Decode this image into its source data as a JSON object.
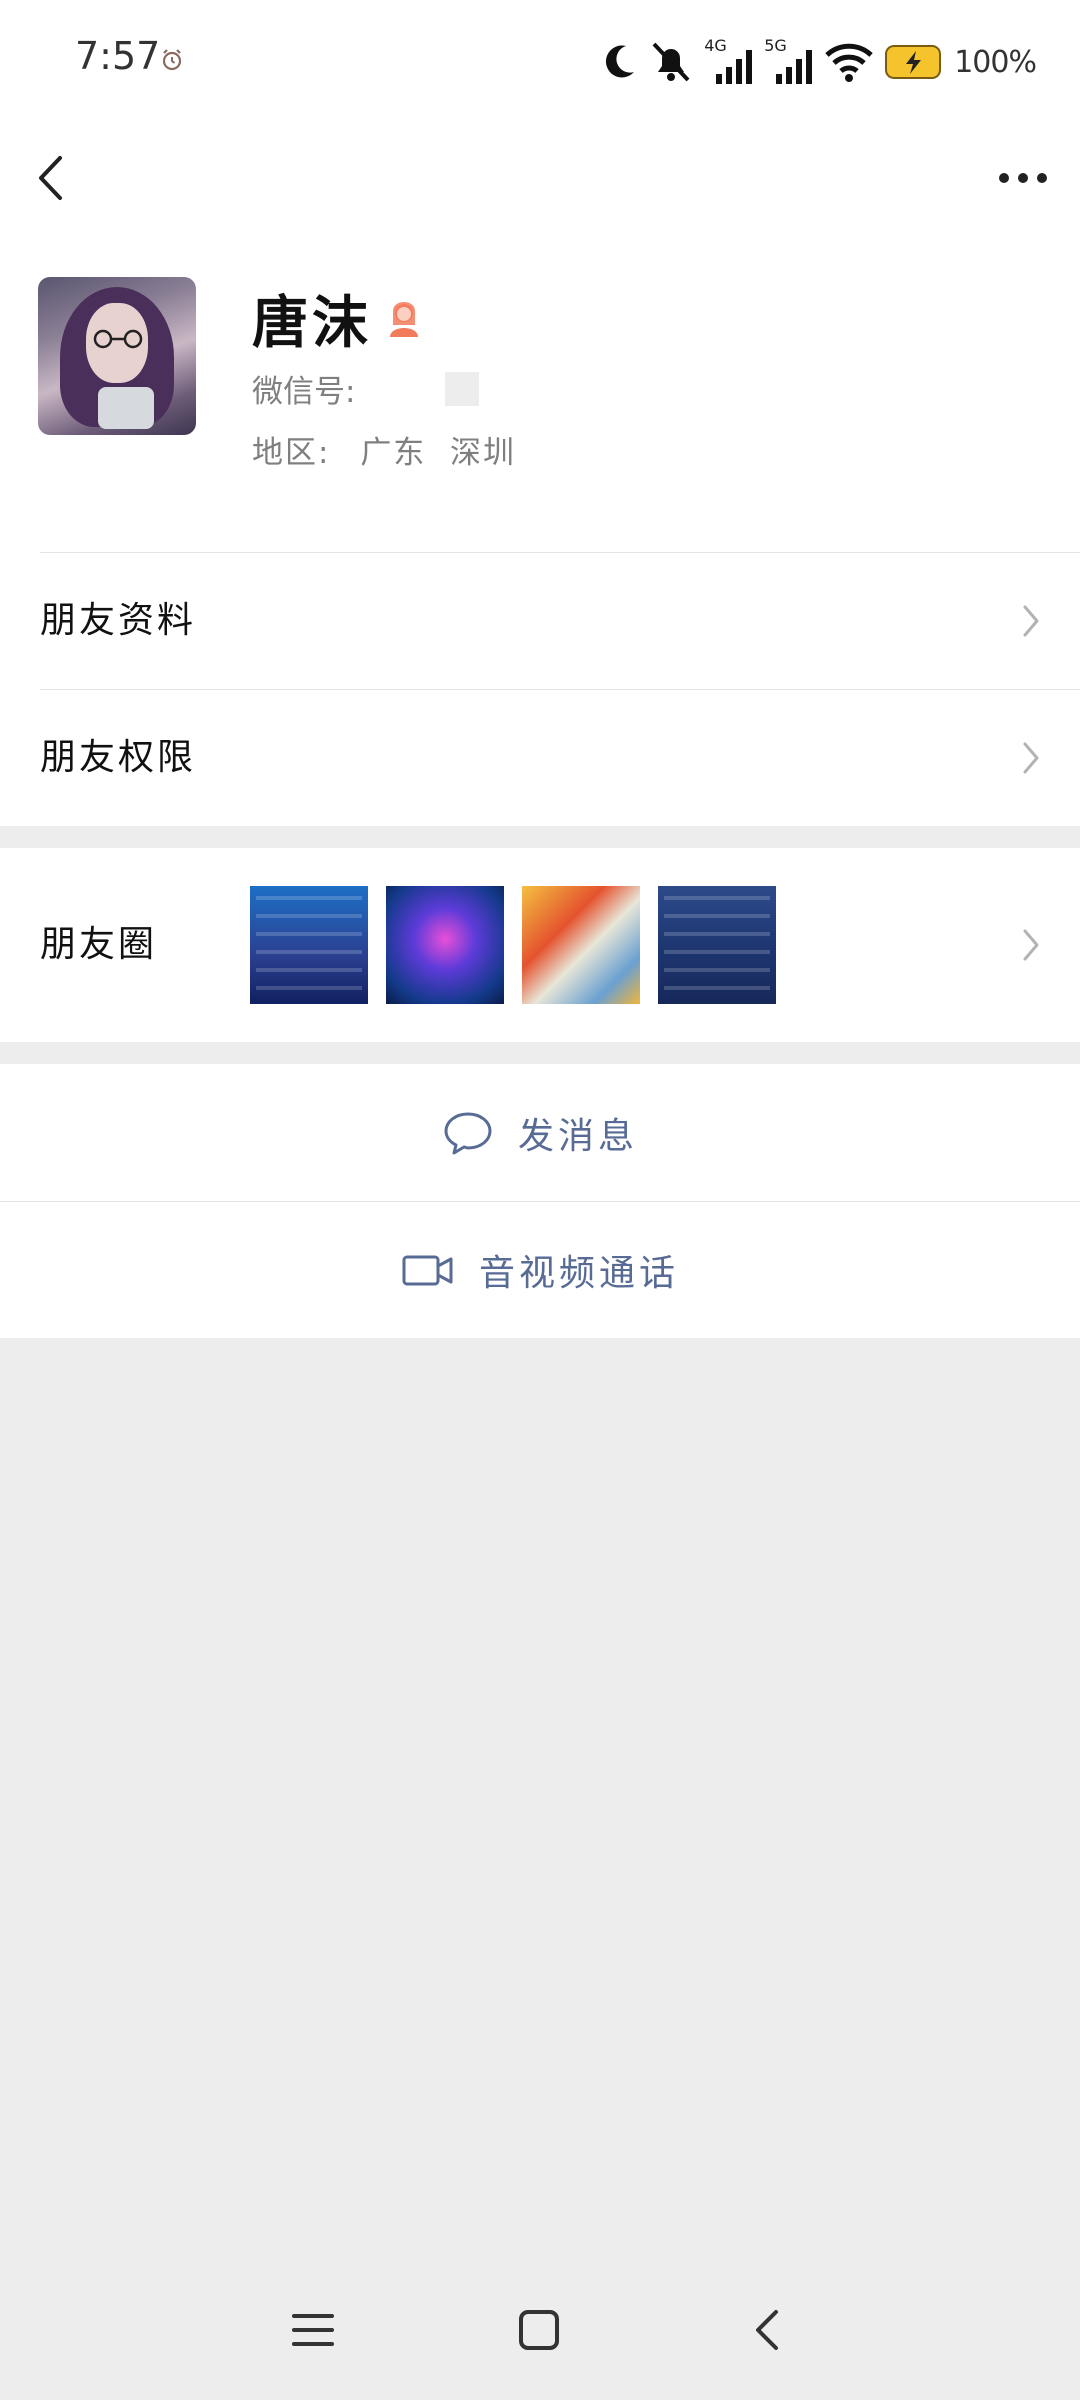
{
  "status_bar": {
    "time": "7:57",
    "network_1": "4G",
    "network_2": "5G",
    "battery": "100%",
    "icons": [
      "alarm-icon",
      "moon-icon",
      "mute-icon",
      "signal-icon",
      "wifi-icon",
      "battery-charging-icon"
    ]
  },
  "header": {
    "back_icon": "back-chevron-icon",
    "more_icon": "more-dots-icon"
  },
  "profile": {
    "name": "唐沫",
    "gender_icon": "female-icon",
    "gender_color": "#f37b5c",
    "wechat_id_label": "微信号:",
    "region_label": "地区:",
    "region_value": "广东  深圳"
  },
  "menu": {
    "friend_info": "朋友资料",
    "friend_permissions": "朋友权限",
    "moments": "朋友圈"
  },
  "actions": {
    "send_message": "发消息",
    "video_call": "音视频通话",
    "accent_color": "#576b95"
  }
}
